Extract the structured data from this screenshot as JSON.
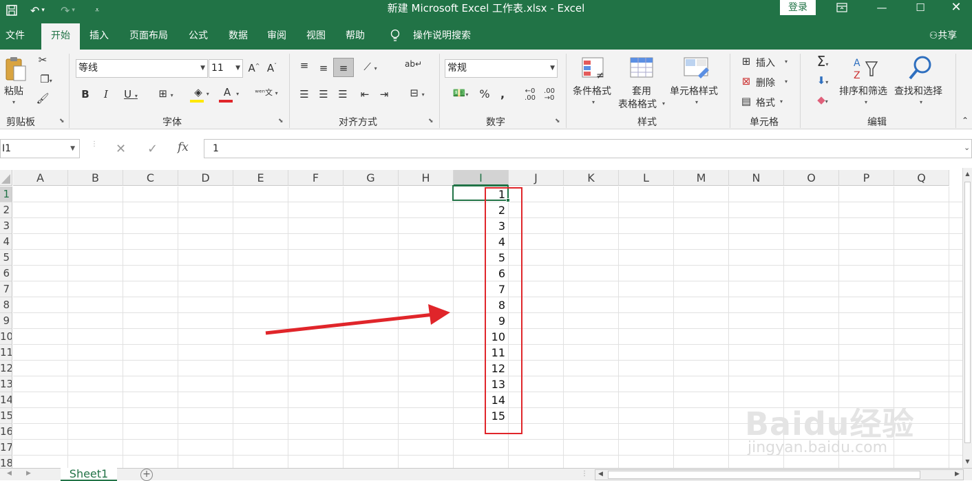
{
  "titlebar": {
    "title": "新建 Microsoft Excel 工作表.xlsx  -  Excel",
    "signin": "登录"
  },
  "menu": [
    "文件",
    "开始",
    "插入",
    "页面布局",
    "公式",
    "数据",
    "审阅",
    "视图",
    "帮助",
    "操作说明搜索"
  ],
  "active_tab": "开始",
  "share": "共享",
  "ribbon": {
    "clipboard": {
      "paste": "粘贴",
      "label": "剪贴板"
    },
    "font": {
      "name": "等线",
      "size": "11",
      "label": "字体"
    },
    "alignment": {
      "label": "对齐方式"
    },
    "number": {
      "format": "常规",
      "label": "数字"
    },
    "styles": {
      "conditional": "条件格式",
      "table_1": "套用",
      "table_2": "表格格式",
      "cell_styles": "单元格样式",
      "label": "样式"
    },
    "cells": {
      "insert": "插入",
      "delete": "删除",
      "format": "格式",
      "label": "单元格"
    },
    "editing": {
      "sort": "排序和筛选",
      "find": "查找和选择",
      "label": "编辑"
    }
  },
  "formula": {
    "namebox": "I1",
    "value": "1"
  },
  "columns": [
    "A",
    "B",
    "C",
    "D",
    "E",
    "F",
    "G",
    "H",
    "I",
    "J",
    "K",
    "L",
    "M",
    "N",
    "O",
    "P",
    "Q"
  ],
  "rows": [
    "1",
    "2",
    "3",
    "4",
    "5",
    "6",
    "7",
    "8",
    "9",
    "10",
    "11",
    "12",
    "13",
    "14",
    "15",
    "16",
    "17",
    "18"
  ],
  "selected_cell": "I1",
  "column_i_values": [
    "1",
    "2",
    "3",
    "4",
    "5",
    "6",
    "7",
    "8",
    "9",
    "10",
    "11",
    "12",
    "13",
    "14",
    "15"
  ],
  "sheets": [
    "Sheet1"
  ],
  "watermark": {
    "text": "Baidu经验",
    "url": "jingyan.baidu.com"
  },
  "colors": {
    "excel_green": "#217346",
    "annotation_red": "#e0252a"
  }
}
